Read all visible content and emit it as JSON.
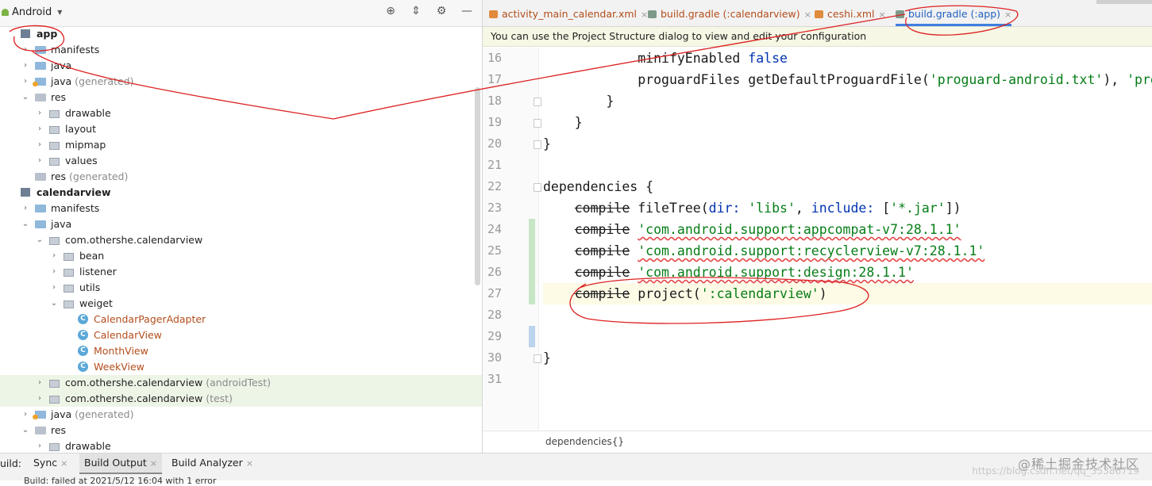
{
  "left_pane": {
    "view_name": "Android",
    "tree": [
      {
        "label": "app",
        "suffix": "",
        "kind": "module",
        "arrow": "",
        "bold": true
      },
      {
        "label": "manifests",
        "suffix": "",
        "kind": "folder-blue",
        "arrow": "right"
      },
      {
        "label": "java",
        "suffix": "",
        "kind": "folder-blue",
        "arrow": "right"
      },
      {
        "label": "java",
        "suffix": "(generated)",
        "kind": "gen",
        "arrow": "right"
      },
      {
        "label": "res",
        "suffix": "",
        "kind": "folder",
        "arrow": "down"
      },
      {
        "label": "drawable",
        "suffix": "",
        "kind": "pkg",
        "arrow": "right"
      },
      {
        "label": "layout",
        "suffix": "",
        "kind": "pkg",
        "arrow": "right"
      },
      {
        "label": "mipmap",
        "suffix": "",
        "kind": "pkg",
        "arrow": "right"
      },
      {
        "label": "values",
        "suffix": "",
        "kind": "pkg",
        "arrow": "right"
      },
      {
        "label": "res",
        "suffix": "(generated)",
        "kind": "folder",
        "arrow": ""
      },
      {
        "label": "calendarview",
        "suffix": "",
        "kind": "module",
        "arrow": "",
        "bold": true
      },
      {
        "label": "manifests",
        "suffix": "",
        "kind": "folder-blue",
        "arrow": "right"
      },
      {
        "label": "java",
        "suffix": "",
        "kind": "folder-blue",
        "arrow": "down"
      },
      {
        "label": "com.othershe.calendarview",
        "suffix": "",
        "kind": "pkg",
        "arrow": "down"
      },
      {
        "label": "bean",
        "suffix": "",
        "kind": "pkg",
        "arrow": "right"
      },
      {
        "label": "listener",
        "suffix": "",
        "kind": "pkg",
        "arrow": "right"
      },
      {
        "label": "utils",
        "suffix": "",
        "kind": "pkg",
        "arrow": "right"
      },
      {
        "label": "weiget",
        "suffix": "",
        "kind": "pkg",
        "arrow": "down"
      },
      {
        "label": "CalendarPagerAdapter",
        "suffix": "",
        "kind": "class",
        "arrow": "",
        "orange": true
      },
      {
        "label": "CalendarView",
        "suffix": "",
        "kind": "class",
        "arrow": "",
        "orange": true
      },
      {
        "label": "MonthView",
        "suffix": "",
        "kind": "class",
        "arrow": "",
        "orange": true
      },
      {
        "label": "WeekView",
        "suffix": "",
        "kind": "class",
        "arrow": "",
        "orange": true
      },
      {
        "label": "com.othershe.calendarview",
        "suffix": "(androidTest)",
        "kind": "pkg",
        "arrow": "right",
        "selected": true
      },
      {
        "label": "com.othershe.calendarview",
        "suffix": "(test)",
        "kind": "pkg",
        "arrow": "right",
        "selected": true
      },
      {
        "label": "java",
        "suffix": "(generated)",
        "kind": "gen",
        "arrow": "right"
      },
      {
        "label": "res",
        "suffix": "",
        "kind": "folder",
        "arrow": "down"
      },
      {
        "label": "drawable",
        "suffix": "",
        "kind": "pkg",
        "arrow": "right"
      }
    ]
  },
  "editor": {
    "tabs": [
      {
        "label": "activity_main_calendar.xml",
        "icon": "xml-file-icon",
        "active": false
      },
      {
        "label": "build.gradle (:calendarview)",
        "icon": "gradle-icon",
        "active": false
      },
      {
        "label": "ceshi.xml",
        "icon": "xml-file-icon",
        "active": false
      },
      {
        "label": "build.gradle (:app)",
        "icon": "gradle-icon",
        "active": true
      }
    ],
    "notice": "You can use the Project Structure dialog to view and edit your configuration",
    "line_numbers": [
      "16",
      "17",
      "18",
      "19",
      "20",
      "21",
      "22",
      "23",
      "24",
      "25",
      "26",
      "27",
      "28",
      "29",
      "30",
      "31"
    ],
    "code_lines": [
      [
        {
          "t": "            minifyEnabled ",
          "c": ""
        },
        {
          "t": "false",
          "c": "kw"
        }
      ],
      [
        {
          "t": "            proguardFiles getDefaultProguardFile(",
          "c": ""
        },
        {
          "t": "'proguard-android.txt'",
          "c": "str"
        },
        {
          "t": "), ",
          "c": ""
        },
        {
          "t": "'proguard-rules.pro'",
          "c": "str"
        }
      ],
      [
        {
          "t": "        }",
          "c": ""
        }
      ],
      [
        {
          "t": "    }",
          "c": ""
        }
      ],
      [
        {
          "t": "}",
          "c": ""
        }
      ],
      [
        {
          "t": "",
          "c": ""
        }
      ],
      [
        {
          "t": "dependencies {",
          "c": ""
        }
      ],
      [
        {
          "t": "    ",
          "c": ""
        },
        {
          "t": "compile",
          "c": "strike"
        },
        {
          "t": " fileTree(",
          "c": ""
        },
        {
          "t": "dir: ",
          "c": "kw"
        },
        {
          "t": "'libs'",
          "c": "str"
        },
        {
          "t": ", ",
          "c": ""
        },
        {
          "t": "include: ",
          "c": "kw"
        },
        {
          "t": "[",
          "c": ""
        },
        {
          "t": "'*.jar'",
          "c": "str"
        },
        {
          "t": "])",
          "c": ""
        }
      ],
      [
        {
          "t": "    ",
          "c": ""
        },
        {
          "t": "compile",
          "c": "strike"
        },
        {
          "t": " ",
          "c": ""
        },
        {
          "t": "'com.android.support:appcompat-v7:28.1.1'",
          "c": "str wavy"
        }
      ],
      [
        {
          "t": "    ",
          "c": ""
        },
        {
          "t": "compile",
          "c": "strike"
        },
        {
          "t": " ",
          "c": ""
        },
        {
          "t": "'com.android.support:recyclerview-v7:28.1.1'",
          "c": "str wavy"
        }
      ],
      [
        {
          "t": "    ",
          "c": ""
        },
        {
          "t": "compile",
          "c": "strike"
        },
        {
          "t": " ",
          "c": ""
        },
        {
          "t": "'com.android.support:design:28.1.1'",
          "c": "str wavy"
        }
      ],
      [
        {
          "t": "    ",
          "c": ""
        },
        {
          "t": "compile",
          "c": "strike"
        },
        {
          "t": " project(",
          "c": ""
        },
        {
          "t": "':calendarview'",
          "c": "str"
        },
        {
          "t": ")",
          "c": ""
        }
      ],
      [
        {
          "t": "",
          "c": ""
        }
      ],
      [
        {
          "t": "",
          "c": ""
        }
      ],
      [
        {
          "t": "}",
          "c": ""
        }
      ],
      [
        {
          "t": "",
          "c": ""
        }
      ]
    ],
    "breadcrumb": "dependencies{}"
  },
  "bottom": {
    "build_label": "uild:",
    "tabs": [
      {
        "label": "Sync",
        "close": true,
        "active": false
      },
      {
        "label": "Build Output",
        "close": true,
        "active": true
      },
      {
        "label": "Build Analyzer",
        "close": true,
        "active": false
      }
    ],
    "status_line": "Build: failed  at 2021/5/12 16:04 with 1 error",
    "watermark": "@稀土掘金技术社区",
    "watermark2": "https://blog.csdn.net/qq_35386719"
  }
}
